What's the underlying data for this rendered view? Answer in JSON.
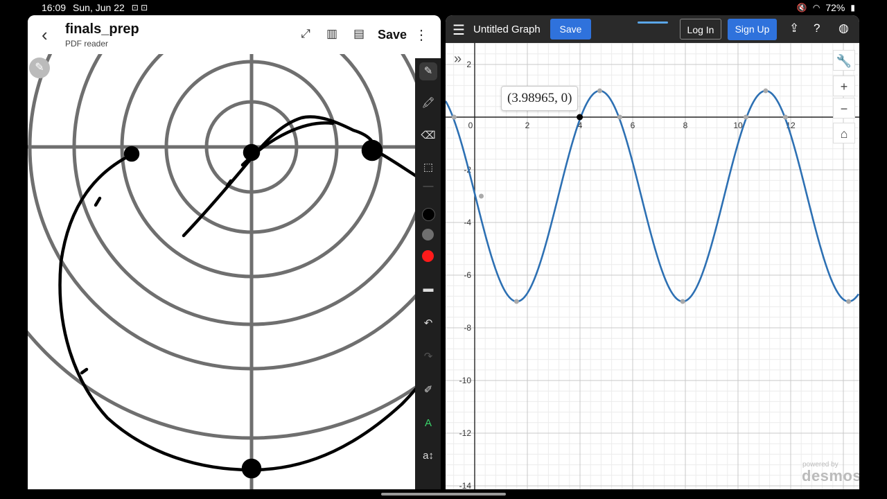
{
  "status": {
    "time": "16:09",
    "date": "Sun, Jun 22",
    "battery": "72%"
  },
  "pdf": {
    "title": "finals_prep",
    "subtitle": "PDF reader",
    "save_label": "Save"
  },
  "colors": {
    "black": "#000000",
    "gray": "#6f6f6f",
    "red": "#ff1a1a",
    "curve": "#2d70b3"
  },
  "desmos": {
    "graph_title": "Untitled Graph",
    "save_label": "Save",
    "login_label": "Log In",
    "signup_label": "Sign Up",
    "tooltip": "(3.98965, 0)",
    "powered_by": "powered by",
    "brand": "desmos",
    "x_ticks": [
      "0",
      "2",
      "4",
      "6",
      "8",
      "10",
      "12"
    ],
    "y_ticks": [
      "2",
      "-2",
      "-4",
      "-6",
      "-8",
      "-10",
      "-12",
      "-14"
    ]
  }
}
